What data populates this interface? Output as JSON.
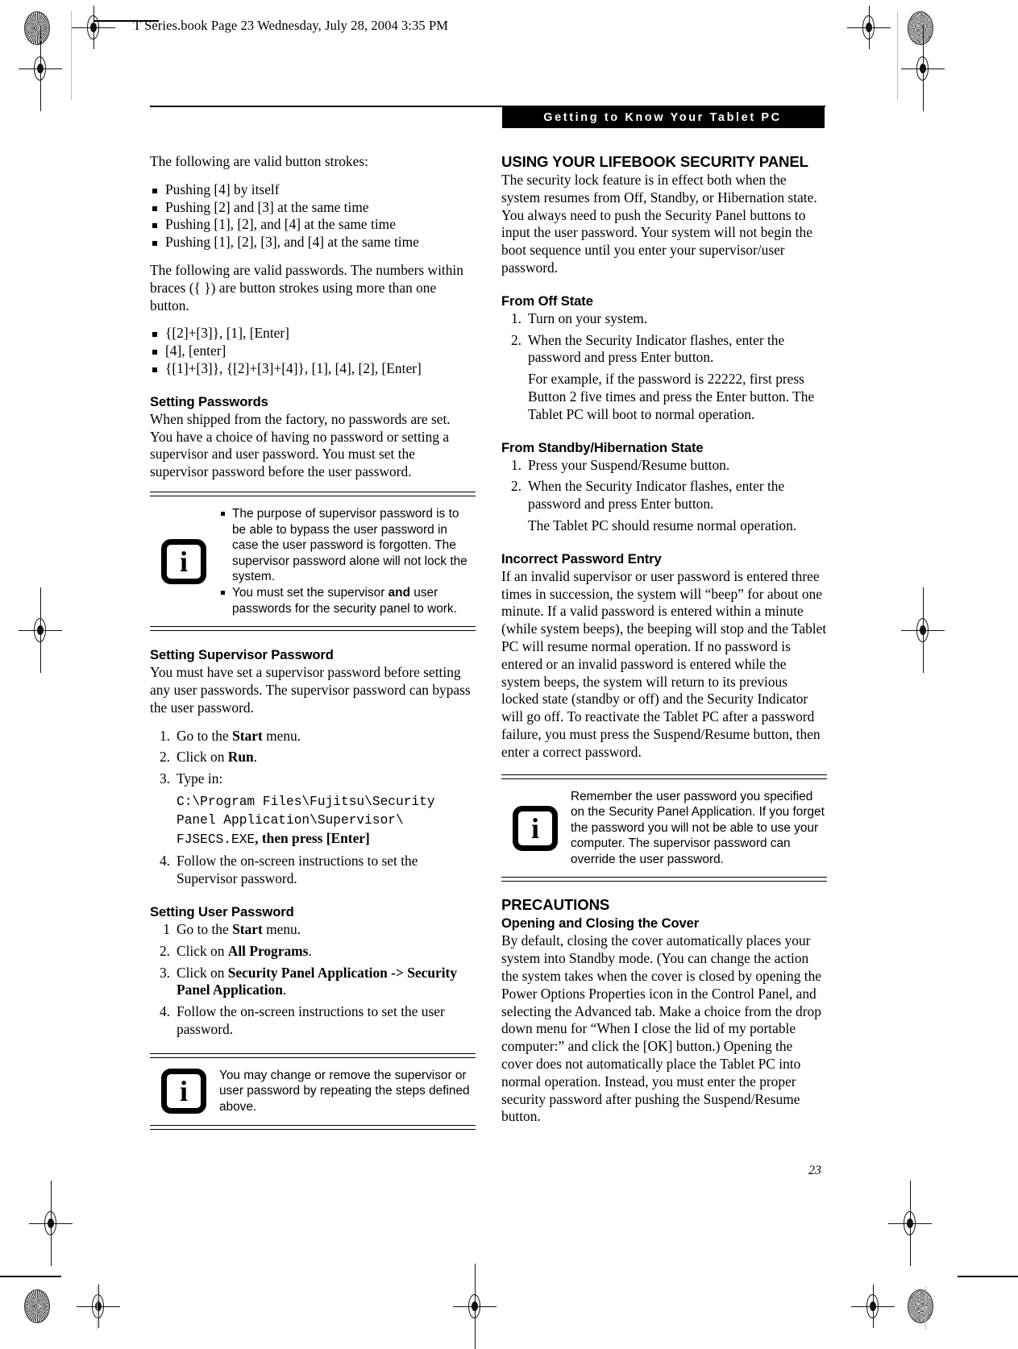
{
  "slug": {
    "text": "T Series.book  Page 23  Wednesday, July 28, 2004  3:35 PM"
  },
  "header": {
    "banner_title": "Getting to Know Your Tablet PC"
  },
  "page_number": "23",
  "left_column": {
    "intro_strokes": "The following are valid button strokes:",
    "stroke_items": [
      "Pushing [4] by itself",
      "Pushing [2] and [3] at the same time",
      "Pushing [1], [2], and [4] at the same time",
      "Pushing [1], [2], [3], and [4] at the same time"
    ],
    "intro_passwords": "The following are valid passwords. The numbers within braces ({  }) are button strokes using more than one button.",
    "password_items": [
      "{[2]+[3]}, [1], [Enter]",
      "[4], [enter]",
      "{[1]+[3]}, {[2]+[3]+[4]}, [1], [4], [2], [Enter]"
    ],
    "setting_passwords": {
      "heading": "Setting Passwords",
      "body": "When shipped from the factory, no passwords are set. You have a choice of having no password or setting a supervisor and user password. You must set the supervisor password before the user password."
    },
    "note_1": {
      "icon": "info-icon",
      "glyph": "i",
      "bullets": [
        "The purpose of supervisor password is to be able to bypass the user password in case the user password is forgotten. The supervisor password alone will not lock the system.",
        "You must set the supervisor and user passwords for the security panel to work."
      ],
      "bullet_2_pre": "You must set the supervisor ",
      "bullet_2_bold": "and",
      "bullet_2_post": " user passwords for the security panel to work."
    },
    "setting_supervisor": {
      "heading": "Setting Supervisor Password",
      "body": "You must have set a supervisor password before setting any user passwords. The supervisor password can bypass the user password.",
      "steps": [
        {
          "num": "1.",
          "pre": "Go to the ",
          "bold": "Start",
          "post": " menu."
        },
        {
          "num": "2.",
          "pre": "Click on ",
          "bold": "Run",
          "post": "."
        },
        {
          "num": "3.",
          "pre": "Type in:",
          "bold": "",
          "post": ""
        },
        {
          "num": "4.",
          "pre": "Follow the on-screen instructions to set the Supervisor password.",
          "bold": "",
          "post": ""
        }
      ],
      "code_line_1": "C:\\Program Files\\Fujitsu\\Security",
      "code_line_2": "Panel Application\\Supervisor\\",
      "code_line_3": "FJSECS.EXE",
      "code_tail": ", then press [Enter]"
    },
    "setting_user": {
      "heading": "Setting User Password",
      "steps": [
        {
          "num": "1",
          "pre": "Go to the ",
          "bold": "Start",
          "post": " menu."
        },
        {
          "num": "2.",
          "pre": "Click on ",
          "bold": "All Programs",
          "post": "."
        },
        {
          "num": "3.",
          "pre": "Click on ",
          "bold": "Security Panel Application -> Security Panel Application",
          "post": "."
        },
        {
          "num": "4.",
          "pre": "Follow the on-screen instructions to set the user password.",
          "bold": "",
          "post": ""
        }
      ]
    },
    "note_2": {
      "icon": "info-icon",
      "glyph": "i",
      "text": "You may change or remove the supervisor or user password by repeating the steps defined above."
    }
  },
  "right_column": {
    "security_panel": {
      "heading": "USING YOUR LIFEBOOK SECURITY PANEL",
      "body": "The security lock feature is in effect both when the system resumes from Off, Standby, or Hibernation state. You always need to push the Security Panel buttons to input the user password. Your system will not begin the boot sequence until you enter your supervisor/user password."
    },
    "from_off": {
      "heading": "From Off State",
      "steps": [
        {
          "num": "1.",
          "text": "Turn on your system."
        },
        {
          "num": "2.",
          "text": "When the Security Indicator flashes, enter the password and press Enter button."
        }
      ],
      "example": "For example, if the password is 22222, first press Button 2 five times and press the Enter button. The Tablet PC will boot to normal operation."
    },
    "from_standby": {
      "heading": "From Standby/Hibernation State",
      "steps": [
        {
          "num": "1.",
          "text": "Press your Suspend/Resume button."
        },
        {
          "num": "2.",
          "text": "When the Security Indicator flashes, enter the password and press Enter button."
        }
      ],
      "example": "The Tablet PC should resume normal operation."
    },
    "incorrect_entry": {
      "heading": "Incorrect Password Entry",
      "body": "If an invalid supervisor or user password is entered three times in succession, the system will “beep” for about one minute. If a valid password is entered within a minute (while system beeps), the beeping will stop and the Tablet PC will resume normal operation. If no password is entered or an invalid password is entered while the system beeps, the system will return to its previous locked state (standby or off) and the Security Indicator will go off. To reactivate the Tablet PC after a password failure, you must press the Suspend/Resume button, then enter a correct password."
    },
    "note_3": {
      "icon": "info-icon",
      "glyph": "i",
      "text": "Remember the user password you specified on the Security Panel Application. If you forget the password you will not be able to use your computer. The supervisor password can override the user password."
    },
    "precautions": {
      "heading": "PRECAUTIONS",
      "subheading": "Opening and Closing the Cover",
      "body": "By default, closing the cover automatically places your system into Standby mode. (You can change the action the system takes when the cover is closed by opening the Power Options Properties icon in the Control Panel, and selecting the Advanced tab. Make a choice from the drop down menu for “When I close the lid of my portable computer:” and click the [OK] button.) Opening the cover does not automatically place the Tablet PC into normal operation. Instead, you must enter the proper security password after pushing the Suspend/Resume button."
    }
  }
}
